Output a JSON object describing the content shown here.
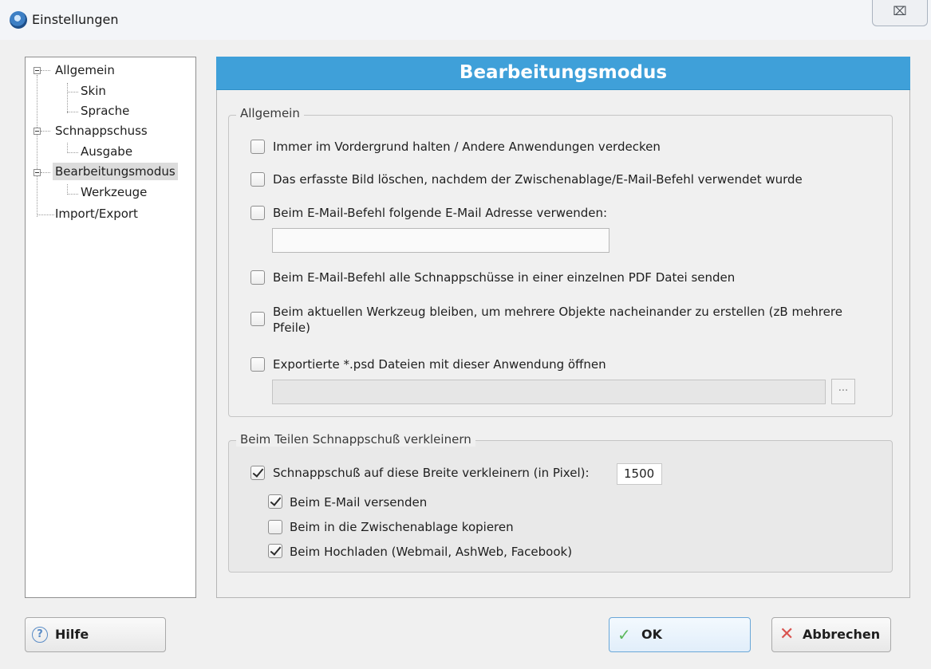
{
  "window": {
    "title": "Einstellungen",
    "close_glyph": "⌧"
  },
  "tree": {
    "items": [
      {
        "label": "Allgemein"
      },
      {
        "label": "Skin"
      },
      {
        "label": "Sprache"
      },
      {
        "label": "Schnappschuss"
      },
      {
        "label": "Ausgabe"
      },
      {
        "label": "Bearbeitungsmodus"
      },
      {
        "label": "Werkzeuge"
      },
      {
        "label": "Import/Export"
      }
    ],
    "selected": "Bearbeitungsmodus"
  },
  "header": {
    "title": "Bearbeitungsmodus"
  },
  "general": {
    "legend": "Allgemein",
    "options": [
      {
        "label": "Immer im Vordergrund halten / Andere Anwendungen verdecken",
        "checked": false
      },
      {
        "label": "Das erfasste Bild löschen, nachdem der Zwischenablage/E-Mail-Befehl verwendet wurde",
        "checked": false
      },
      {
        "label": "Beim E-Mail-Befehl folgende E-Mail Adresse verwenden:",
        "checked": false
      },
      {
        "label": "Beim E-Mail-Befehl alle Schnappschüsse in einer einzelnen PDF Datei senden",
        "checked": false
      },
      {
        "label": "Beim aktuellen Werkzeug bleiben, um mehrere Objekte nacheinander zu erstellen (zB mehrere Pfeile)",
        "checked": false
      },
      {
        "label": "Exportierte *.psd Dateien mit dieser Anwendung öffnen",
        "checked": false
      }
    ],
    "email_value": "",
    "app_path_value": "",
    "browse_label": "..."
  },
  "resize": {
    "legend": "Beim Teilen Schnappschuß verkleinern",
    "main": {
      "label": "Schnappschuß auf diese Breite verkleinern (in Pixel):",
      "checked": true
    },
    "width_value": "1500",
    "options": [
      {
        "label": "Beim E-Mail versenden",
        "checked": true
      },
      {
        "label": "Beim in die Zwischenablage kopieren",
        "checked": false
      },
      {
        "label": "Beim Hochladen (Webmail, AshWeb, Facebook)",
        "checked": true
      }
    ]
  },
  "buttons": {
    "help": "Hilfe",
    "help_glyph": "?",
    "ok": "OK",
    "ok_glyph": "✓",
    "cancel": "Abbrechen",
    "cancel_glyph": "✕"
  },
  "colors": {
    "header_bg": "#3fa0d9",
    "ok_icon": "#5cb85c",
    "cancel_icon": "#d9534f"
  }
}
